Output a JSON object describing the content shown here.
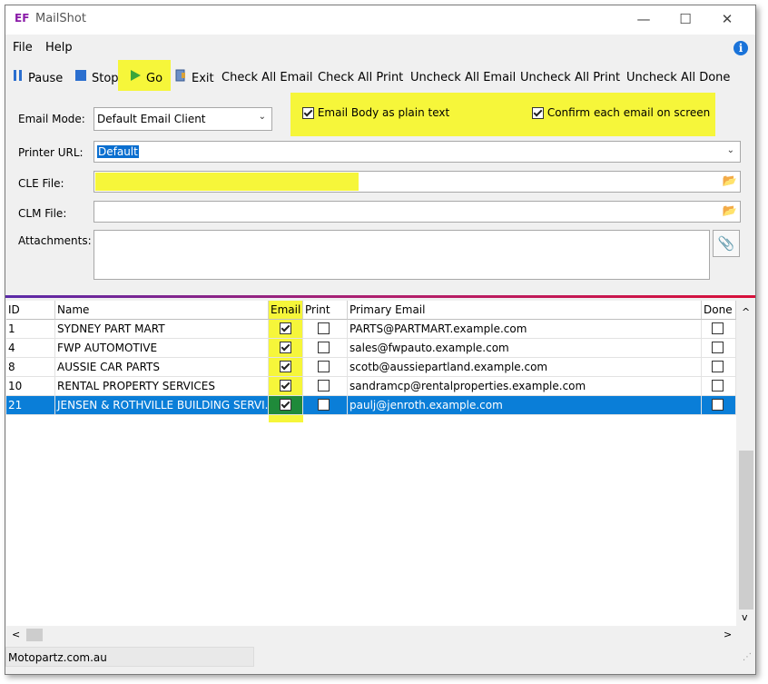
{
  "window": {
    "logo": "EF",
    "title": "MailShot",
    "minimize": "—",
    "maximize": "☐",
    "close": "✕"
  },
  "menu": {
    "file": "File",
    "help": "Help",
    "info": "i"
  },
  "toolbar": {
    "pause": "Pause",
    "stop": "Stop",
    "go": "Go",
    "exit": "Exit",
    "check_all_email": "Check All Email",
    "check_all_print": "Check All Print",
    "uncheck_all_email": "Uncheck All Email",
    "uncheck_all_print": "Uncheck All Print",
    "uncheck_all_done": "Uncheck All Done"
  },
  "form": {
    "email_mode_label": "Email Mode:",
    "email_mode_value": "Default Email Client",
    "plain_text_label": "Email Body as plain text",
    "plain_text_checked": true,
    "confirm_label": "Confirm each email on screen",
    "confirm_checked": true,
    "printer_url_label": "Printer URL:",
    "printer_url_value": "Default",
    "cle_file_label": "CLE File:",
    "cle_file_value": "",
    "clm_file_label": "CLM File:",
    "clm_file_value": "",
    "attachments_label": "Attachments:"
  },
  "grid": {
    "headers": {
      "id": "ID",
      "name": "Name",
      "email": "Email",
      "print": "Print",
      "primary_email": "Primary Email",
      "done": "Done"
    },
    "rows": [
      {
        "id": "1",
        "name": "SYDNEY PART MART",
        "email": true,
        "print": false,
        "primary_email": "PARTS@PARTMART.example.com",
        "done": false
      },
      {
        "id": "4",
        "name": "FWP AUTOMOTIVE",
        "email": true,
        "print": false,
        "primary_email": "sales@fwpauto.example.com",
        "done": false
      },
      {
        "id": "8",
        "name": "AUSSIE CAR PARTS",
        "email": true,
        "print": false,
        "primary_email": "scotb@aussiepartland.example.com",
        "done": false
      },
      {
        "id": "10",
        "name": "RENTAL PROPERTY SERVICES",
        "email": true,
        "print": false,
        "primary_email": "sandramcp@rentalproperties.example.com",
        "done": false
      },
      {
        "id": "21",
        "name": "JENSEN & ROTHVILLE BUILDING SERVI...",
        "email": true,
        "print": false,
        "primary_email": "paulj@jenroth.example.com",
        "done": false,
        "selected": true
      }
    ]
  },
  "scroll": {
    "up": "^",
    "down": "v",
    "left": "<",
    "right": ">"
  },
  "status": {
    "text": "Motopartz.com.au"
  },
  "colors": {
    "highlight": "#f6f63a",
    "selection": "#0a7ed8",
    "brand": "#8a1ba8"
  }
}
